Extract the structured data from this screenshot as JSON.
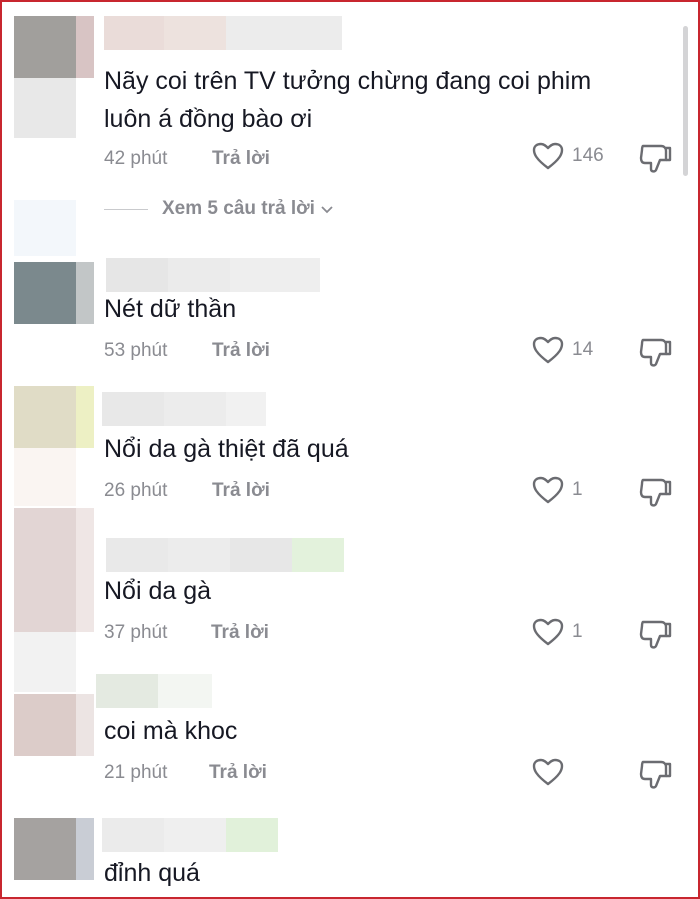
{
  "comments": [
    {
      "text_lines": [
        "Nãy coi trên TV tưởng chừng đang coi phim",
        "luôn á đồng bào ơi"
      ],
      "time": "42 phút",
      "reply_label": "Trả lời",
      "likes": "146"
    },
    {
      "text_lines": [
        "Nét dữ thần"
      ],
      "time": "53 phút",
      "reply_label": "Trả lời",
      "likes": "14"
    },
    {
      "text_lines": [
        "Nổi da gà thiệt đã quá"
      ],
      "time": "26 phút",
      "reply_label": "Trả lời",
      "likes": "1"
    },
    {
      "text_lines": [
        "Nổi da gà"
      ],
      "time": "37 phút",
      "reply_label": "Trả lời",
      "likes": "1"
    },
    {
      "text_lines": [
        "coi mà khoc"
      ],
      "time": "21 phút",
      "reply_label": "Trả lời",
      "likes": ""
    },
    {
      "text_lines": [
        "đỉnh quá"
      ],
      "time": "",
      "reply_label": "",
      "likes": ""
    }
  ],
  "view_replies": {
    "label": "Xem 5 câu trả lời"
  },
  "colors": {
    "border": "#c8262f",
    "text": "#161823",
    "meta": "#8a8b91"
  },
  "icons": {
    "like": "heart-outline-icon",
    "dislike": "thumbs-down-icon",
    "expand": "chevron-down-icon"
  }
}
